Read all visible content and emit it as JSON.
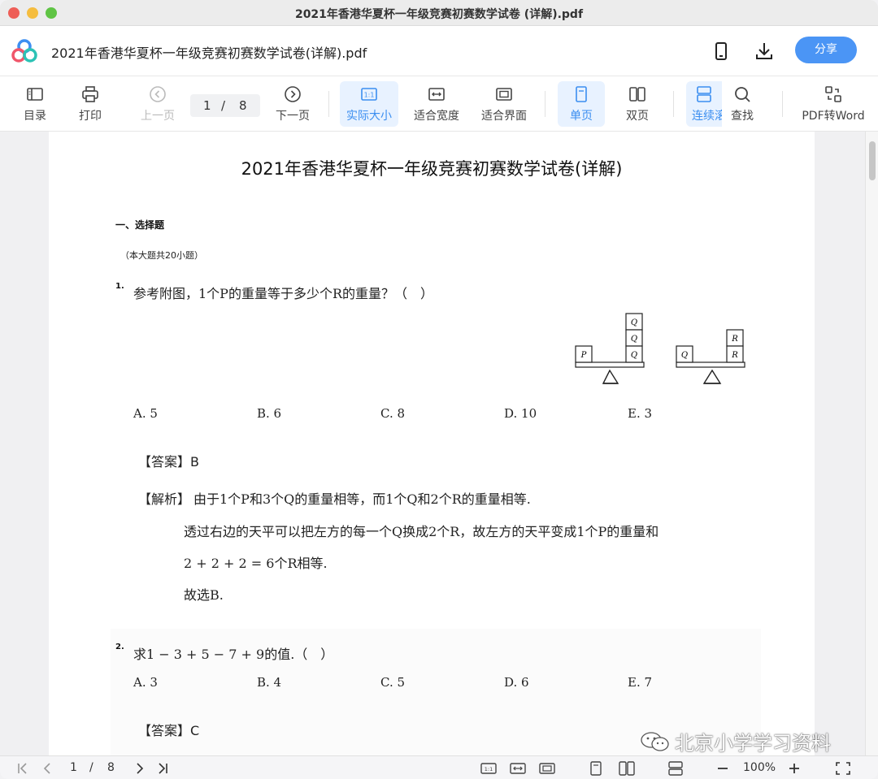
{
  "window": {
    "title": "2021年香港华夏杯一年级竞赛初赛数学试卷 (详解).pdf"
  },
  "header": {
    "doc_title": "2021年香港华夏杯一年级竞赛初赛数学试卷(详解).pdf",
    "share_label": "分享",
    "icons": [
      "app-logo-icon",
      "phone-icon",
      "download-icon"
    ]
  },
  "toolbar": {
    "toc": "目录",
    "print": "打印",
    "prev": "上一页",
    "page_current": "1",
    "page_sep": "/",
    "page_total": "8",
    "next": "下一页",
    "actual_size": "实际大小",
    "fit_width": "适合宽度",
    "fit_page": "适合界面",
    "single": "单页",
    "double": "双页",
    "continuous": "连续滚",
    "find": "查找",
    "pdf_word": "PDF转Word"
  },
  "document": {
    "title": "2021年香港华夏杯一年级竞赛初赛数学试卷(详解)",
    "section": "一、选择题",
    "note": "（本大题共20小题）",
    "q1": {
      "num": "1.",
      "text": "参考附图，1个P的重量等于多少个R的重量？（　）",
      "options": [
        "A. 5",
        "B. 6",
        "C. 8",
        "D. 10",
        "E. 3"
      ],
      "answer": "【答案】B",
      "exp_label": "【解析】",
      "exp_lines": [
        "由于1个P和3个Q的重量相等，而1个Q和2个R的重量相等.",
        "透过右边的天平可以把左方的每一个Q换成2个R，故左方的天平变成1个P的重量和",
        "2 + 2 + 2 = 6个R相等.",
        "故选B."
      ],
      "figure_labels": {
        "p": "P",
        "q": "Q",
        "r": "R"
      }
    },
    "q2": {
      "num": "2.",
      "text": "求1 − 3 + 5 − 7 + 9的值.（　）",
      "options": [
        "A. 3",
        "B. 4",
        "C. 5",
        "D. 6",
        "E. 7"
      ],
      "answer": "【答案】C"
    },
    "watermark": "北京小学学习资料"
  },
  "bottombar": {
    "page_current": "1",
    "page_sep": "/",
    "page_total": "8",
    "zoom": "100%"
  },
  "colors": {
    "accent": "#4b95f5",
    "active_bg": "#e8f2ff"
  }
}
